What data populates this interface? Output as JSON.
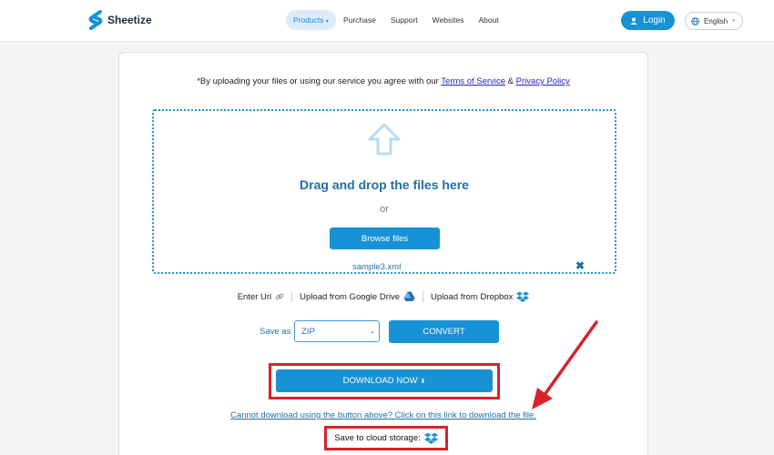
{
  "header": {
    "brand": "Sheetize",
    "nav": [
      {
        "label": "Products",
        "suffix": "▾",
        "active": true
      },
      {
        "label": "Purchase",
        "active": false
      },
      {
        "label": "Support",
        "active": false
      },
      {
        "label": "Websites",
        "active": false
      },
      {
        "label": "About",
        "active": false
      }
    ],
    "login_label": "Login",
    "language": "English"
  },
  "upload": {
    "notice_prefix": "*By uploading your files or using our service you agree with our ",
    "terms_link": "Terms of Service",
    "amp": " & ",
    "privacy_link": "Privacy Policy",
    "drag_title": "Drag and drop the files here",
    "or_text": "or",
    "browse_label": "Browse files",
    "file_name": "sample3.xml",
    "remove_glyph": "✖"
  },
  "sources": {
    "url_label": "Enter Url",
    "gdrive_label": "Upload from Google Drive",
    "dropbox_label": "Upload from Dropbox"
  },
  "convert": {
    "save_as_label": "Save as",
    "format_value": "ZIP",
    "convert_label": "CONVERT"
  },
  "download": {
    "download_label": "DOWNLOAD NOW",
    "download_glyph": "⬇",
    "fallback_link": "Cannot download using the button above? Click on this link to download the file.",
    "cloud_label": "Save to cloud storage:"
  },
  "colors": {
    "accent": "#1792d6",
    "link_blue": "#2224c4",
    "annotation_red": "#d8222b"
  }
}
